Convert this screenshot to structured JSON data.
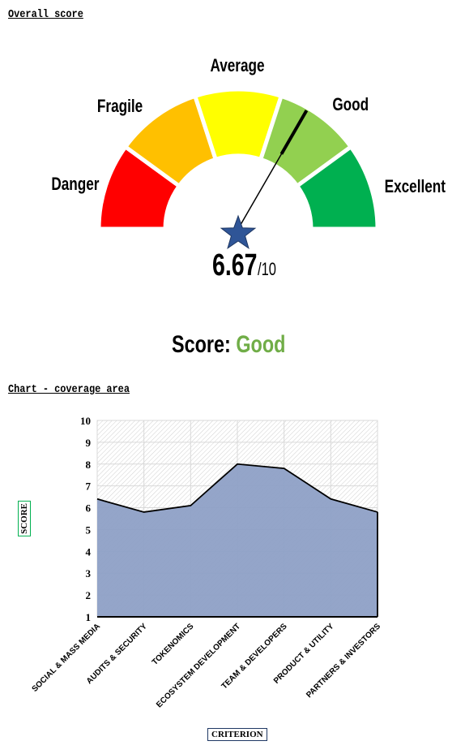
{
  "sections": {
    "overall": "Overall score",
    "chart": "Chart - coverage area"
  },
  "gauge": {
    "segments": [
      {
        "label": "Danger",
        "color": "#ff0000"
      },
      {
        "label": "Fragile",
        "color": "#ffc000"
      },
      {
        "label": "Average",
        "color": "#ffff00"
      },
      {
        "label": "Good",
        "color": "#92d050"
      },
      {
        "label": "Excellent",
        "color": "#00b050"
      }
    ],
    "value": 6.67,
    "max": 10,
    "value_text": "6.67",
    "max_text": "/10",
    "icon": "star-icon"
  },
  "score": {
    "label": "Score:",
    "value": "Good",
    "color": "#70ad47"
  },
  "chart_data": {
    "type": "area",
    "categories": [
      "SOCIAL & MASS MEDIA",
      "AUDITS & SECURITY",
      "TOKENOMICS",
      "ECOSYSTEM DEVELOPMENT",
      "TEAM & DEVELOPERS",
      "PRODUCT & UTILITY",
      "PARTNERS & INVESTORS"
    ],
    "values": [
      6.4,
      5.8,
      6.1,
      8.0,
      7.8,
      6.4,
      5.8
    ],
    "ylim": [
      1,
      10
    ],
    "yticks": [
      "1",
      "2",
      "3",
      "4",
      "5",
      "6",
      "7",
      "8",
      "9",
      "10"
    ],
    "xlabel": "CRITERION",
    "ylabel": "SCORE",
    "grid": true,
    "fill": "#8ea0c6"
  }
}
